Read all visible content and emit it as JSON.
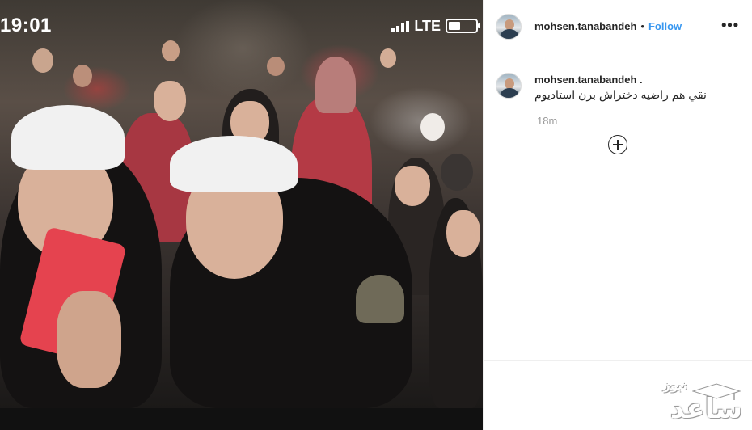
{
  "status_bar": {
    "time": "19:01",
    "network": "LTE",
    "battery_level": 0.45
  },
  "post": {
    "image_icon": "crowd-photo"
  },
  "header": {
    "username": "mohsen.tanabandeh",
    "separator": "•",
    "follow_label": "Follow",
    "more_icon": "more-horizontal-icon",
    "more_label": "•••"
  },
  "comment": {
    "username": "mohsen.tanabandeh",
    "suffix": ".",
    "text": "نقي هم راضيه دختراش برن استاديوم",
    "time": "18m"
  },
  "load_more": {
    "icon": "plus-circle-icon"
  },
  "watermark": {
    "brand": "ساعد",
    "tag": "نیوز"
  },
  "colors": {
    "link": "#3897f0",
    "text": "#262626",
    "muted": "#999999",
    "border": "#efefef"
  }
}
